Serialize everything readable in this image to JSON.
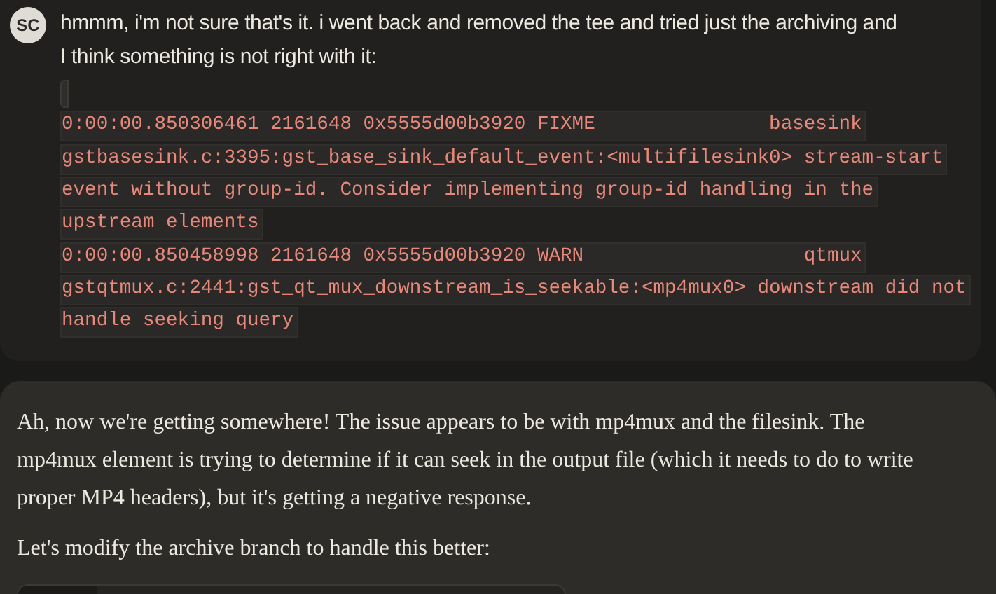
{
  "user_message": {
    "avatar": "SC",
    "text": "hmmm, i'm not sure that's it. i went back and removed the tee and tried just the archiving and I think something is not right with it:",
    "code_lines": [
      "0:00:00.850306461 2161648 0x5555d00b3920 FIXME               basesink",
      "gstbasesink.c:3395:gst_base_sink_default_event:<multifilesink0> stream-start",
      "event without group-id. Consider implementing group-id handling in the",
      "upstream elements",
      "0:00:00.850458998 2161648 0x5555d00b3920 WARN                   qtmux",
      "gstqtmux.c:2441:gst_qt_mux_downstream_is_seekable:<mp4mux0> downstream did not",
      "handle seeking query"
    ]
  },
  "assistant_message": {
    "paragraphs": [
      "Ah, now we're getting somewhere! The issue appears to be with mp4mux and the filesink. The mp4mux element is trying to determine if it can seek in the output file (which it needs to do to write proper MP4 headers), but it's getting a negative response.",
      "Let's modify the archive branch to handle this better:"
    ]
  }
}
